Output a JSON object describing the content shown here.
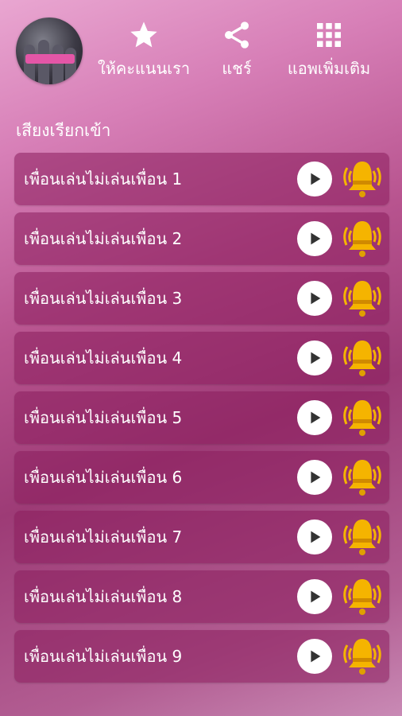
{
  "header": {
    "rate_label": "ให้คะแนนเรา",
    "share_label": "แชร์",
    "more_apps_label": "แอพเพิ่มเติม"
  },
  "section": {
    "title": "เสียงเรียกเข้า"
  },
  "ringtones": [
    {
      "label": "เพื่อนเล่นไม่เล่นเพื่อน 1"
    },
    {
      "label": "เพื่อนเล่นไม่เล่นเพื่อน 2"
    },
    {
      "label": "เพื่อนเล่นไม่เล่นเพื่อน 3"
    },
    {
      "label": "เพื่อนเล่นไม่เล่นเพื่อน 4"
    },
    {
      "label": "เพื่อนเล่นไม่เล่นเพื่อน 5"
    },
    {
      "label": "เพื่อนเล่นไม่เล่นเพื่อน 6"
    },
    {
      "label": "เพื่อนเล่นไม่เล่นเพื่อน 7"
    },
    {
      "label": "เพื่อนเล่นไม่เล่นเพื่อน 8"
    },
    {
      "label": "เพื่อนเล่นไม่เล่นเพื่อน 9"
    }
  ],
  "icons": {
    "rate": "star-icon",
    "share": "share-icon",
    "more_apps": "grid-icon",
    "play": "play-icon",
    "ringtone": "bell-icon"
  },
  "colors": {
    "accent": "#9d3b76",
    "row_bg": "#8a1e5c",
    "bell": "#f5b400",
    "play_arrow": "#333333"
  }
}
